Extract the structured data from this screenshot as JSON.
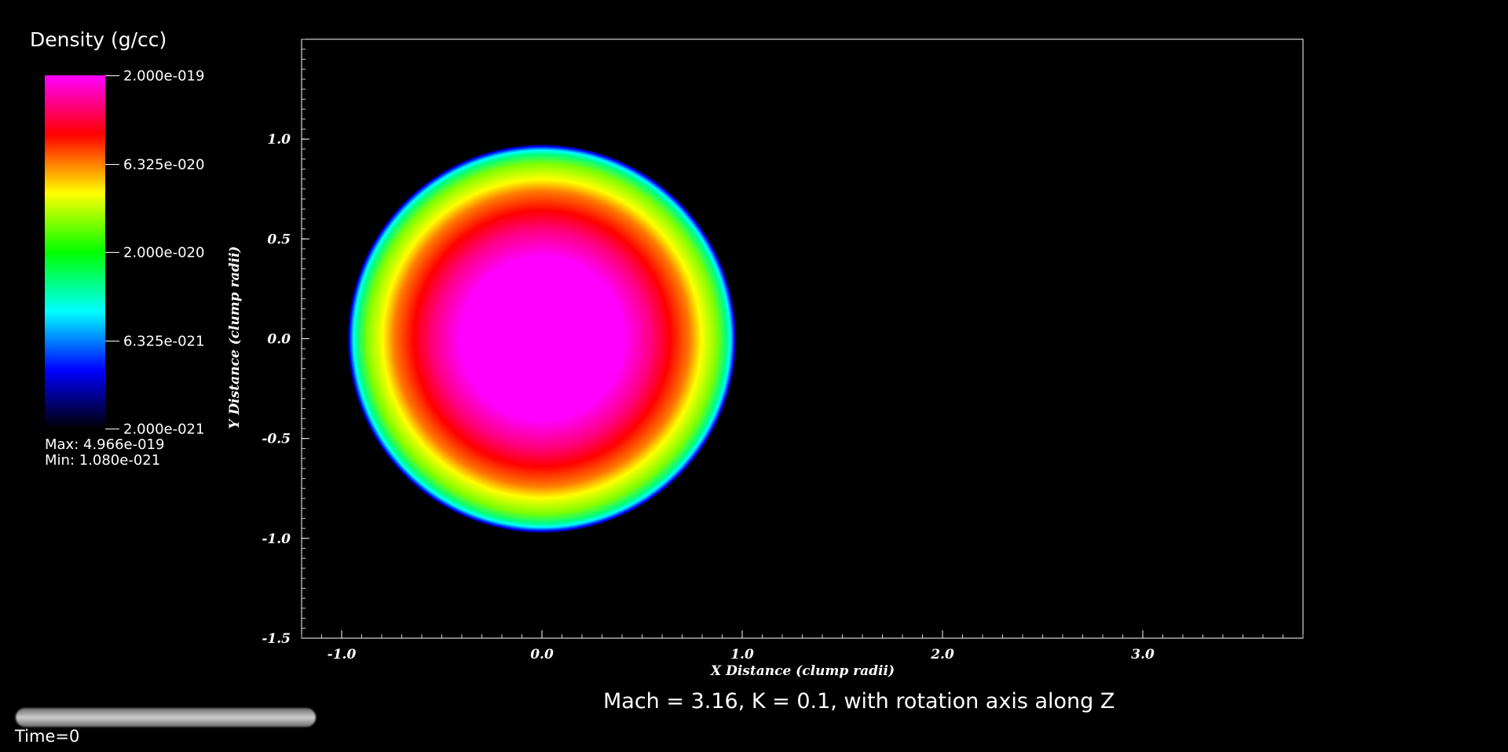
{
  "legend": {
    "title": "Density (g/cc)",
    "ticks": [
      "2.000e-019",
      "6.325e-020",
      "2.000e-020",
      "6.325e-021",
      "2.000e-021"
    ],
    "max_label": "Max:  4.966e-019",
    "min_label": "Min:  1.080e-021",
    "colormap": [
      "#ff00ff",
      "#ff0000",
      "#ffff00",
      "#00ff00",
      "#00ffff",
      "#0000ff",
      "#000000"
    ]
  },
  "subtitle": "Mach = 3.16, K = 0.1, with rotation axis along Z",
  "time_label": "Time=0",
  "chart_data": {
    "type": "heatmap",
    "xlabel": "X Distance (clump radii)",
    "ylabel": "Y Distance (clump radii)",
    "xlim": [
      -1.2,
      3.8
    ],
    "ylim": [
      -1.5,
      1.5
    ],
    "xticks": [
      "-1.0",
      "0.0",
      "1.0",
      "2.0",
      "3.0"
    ],
    "yticks": [
      "1.0",
      "0.5",
      "0.0",
      "-0.5",
      "-1.0",
      "-1.5"
    ],
    "xtick_values": [
      -1.0,
      0.0,
      1.0,
      2.0,
      3.0
    ],
    "ytick_values": [
      1.0,
      0.5,
      0.0,
      -0.5,
      -1.0,
      -1.5
    ],
    "clump": {
      "center": [
        0.0,
        0.0
      ],
      "radius": 0.97
    },
    "grid": false
  }
}
